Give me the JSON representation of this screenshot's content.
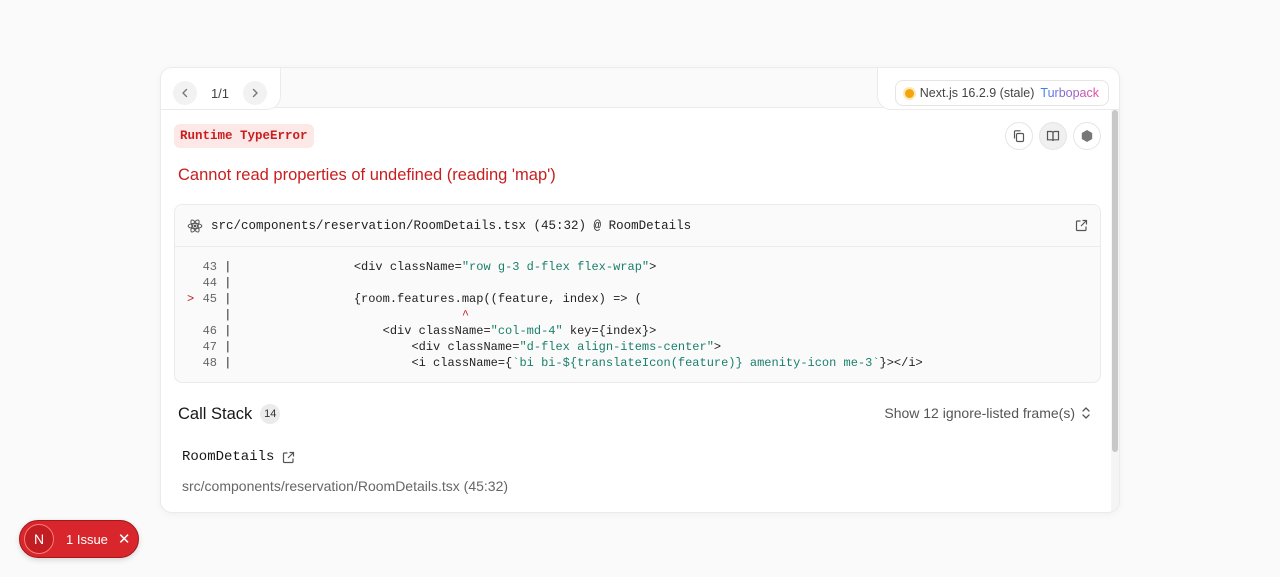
{
  "pager": {
    "count": "1/1"
  },
  "version": {
    "label": "Next.js 16.2.9 (stale)",
    "bundler": "Turbopack",
    "status_color": "#f5a50b"
  },
  "error": {
    "type": "Runtime TypeError",
    "message": "Cannot read properties of undefined (reading 'map')"
  },
  "code": {
    "location": "src/components/reservation/RoomDetails.tsx (45:32) @ RoomDetails",
    "lines": [
      {
        "marker": "",
        "num": "43",
        "pre": "                <div className=",
        "str": "\"row g-3 d-flex flex-wrap\"",
        "post": ">"
      },
      {
        "marker": "",
        "num": "44",
        "pre": "",
        "str": "",
        "post": ""
      },
      {
        "marker": ">",
        "num": "45",
        "pre": "                {room.features.map((feature, index) => (",
        "str": "",
        "post": ""
      },
      {
        "marker": "",
        "num": "",
        "pre": "",
        "str": "",
        "post": "",
        "caret": "                               ^"
      },
      {
        "marker": "",
        "num": "46",
        "pre": "                    <div className=",
        "str": "\"col-md-4\"",
        "post": " key={index}>"
      },
      {
        "marker": "",
        "num": "47",
        "pre": "                        <div className=",
        "str": "\"d-flex align-items-center\"",
        "post": ">"
      },
      {
        "marker": "",
        "num": "48",
        "pre": "                        <i className={",
        "str": "`bi bi-${translateIcon(feature)} amenity-icon me-3`",
        "post": "}></i>"
      }
    ]
  },
  "callstack": {
    "title": "Call Stack",
    "count": "14",
    "ignore_label": "Show 12 ignore-listed frame(s)",
    "frame_name": "RoomDetails",
    "frame_path": "src/components/reservation/RoomDetails.tsx (45:32)"
  },
  "issue_badge": {
    "logo": "N",
    "label": "1 Issue"
  }
}
